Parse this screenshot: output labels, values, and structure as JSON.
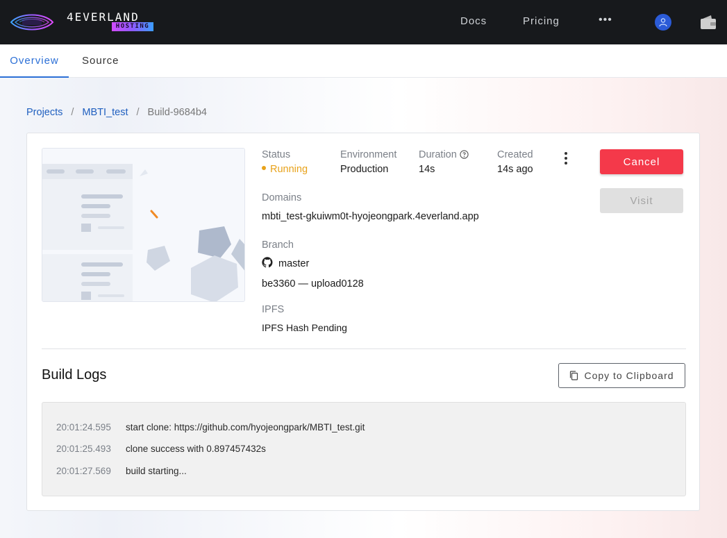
{
  "brand": {
    "wordmark": "4EVERLAND",
    "badge": "HOSTING"
  },
  "nav": {
    "docs": "Docs",
    "pricing": "Pricing",
    "more": "•••"
  },
  "tabs": [
    {
      "label": "Overview",
      "active": true
    },
    {
      "label": "Source",
      "active": false
    }
  ],
  "breadcrumb": {
    "projects": "Projects",
    "sep1": "/",
    "project": "MBTI_test",
    "sep2": "/",
    "build": "Build-9684b4"
  },
  "deployment": {
    "status_label": "Status",
    "status_value": "Running",
    "environment_label": "Environment",
    "environment_value": "Production",
    "duration_label": "Duration",
    "duration_value": "14s",
    "created_label": "Created",
    "created_value": "14s ago",
    "domains_label": "Domains",
    "domains_value": "mbti_test-gkuiwm0t-hyojeongpark.4everland.app",
    "branch_label": "Branch",
    "branch_value": "master",
    "commit_value": "be3360 — upload0128",
    "ipfs_label": "IPFS",
    "ipfs_value": "IPFS Hash Pending"
  },
  "actions": {
    "cancel": "Cancel",
    "visit": "Visit",
    "copy": "Copy to Clipboard"
  },
  "build_logs": {
    "title": "Build Logs",
    "entries": [
      {
        "time": "20:01:24.595",
        "message": "start clone: https://github.com/hyojeongpark/MBTI_test.git"
      },
      {
        "time": "20:01:25.493",
        "message": "clone success with 0.897457432s"
      },
      {
        "time": "20:01:27.569",
        "message": "build starting..."
      }
    ]
  },
  "colors": {
    "accent": "#2b6fd6",
    "danger": "#f4394a",
    "running": "#e8a21a",
    "topbar": "#17191c"
  }
}
